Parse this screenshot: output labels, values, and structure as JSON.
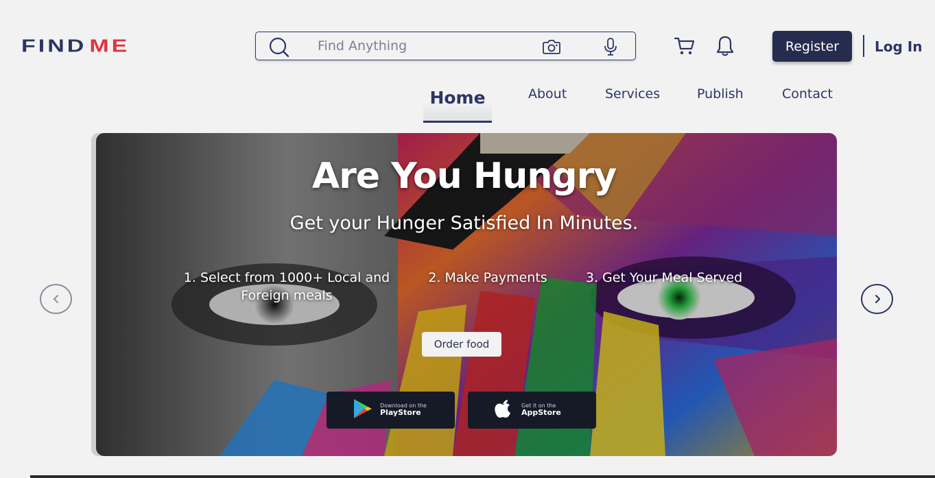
{
  "brand": {
    "part1": "FIND",
    "part2": "ME"
  },
  "search": {
    "placeholder": "Find Anything"
  },
  "header": {
    "register_label": "Register",
    "login_label": "Log In"
  },
  "nav": {
    "items": [
      {
        "label": "Home",
        "active": true
      },
      {
        "label": "About"
      },
      {
        "label": "Services"
      },
      {
        "label": "Publish"
      },
      {
        "label": "Contact"
      }
    ]
  },
  "hero": {
    "title": "Are You Hungry",
    "subtitle": "Get your Hunger Satisfied In Minutes.",
    "steps": [
      "1. Select from 1000+ Local and Foreign meals",
      "2. Make Payments",
      "3. Get Your Meal Served"
    ],
    "cta_label": "Order food",
    "stores": [
      {
        "small": "Download on the",
        "big": "PlayStore",
        "icon": "play-store-icon"
      },
      {
        "small": "Get it on the",
        "big": "AppStore",
        "icon": "apple-icon"
      }
    ]
  },
  "colors": {
    "brand_navy": "#2c3563",
    "brand_red": "#e03340",
    "button_dark": "#262c4d"
  }
}
